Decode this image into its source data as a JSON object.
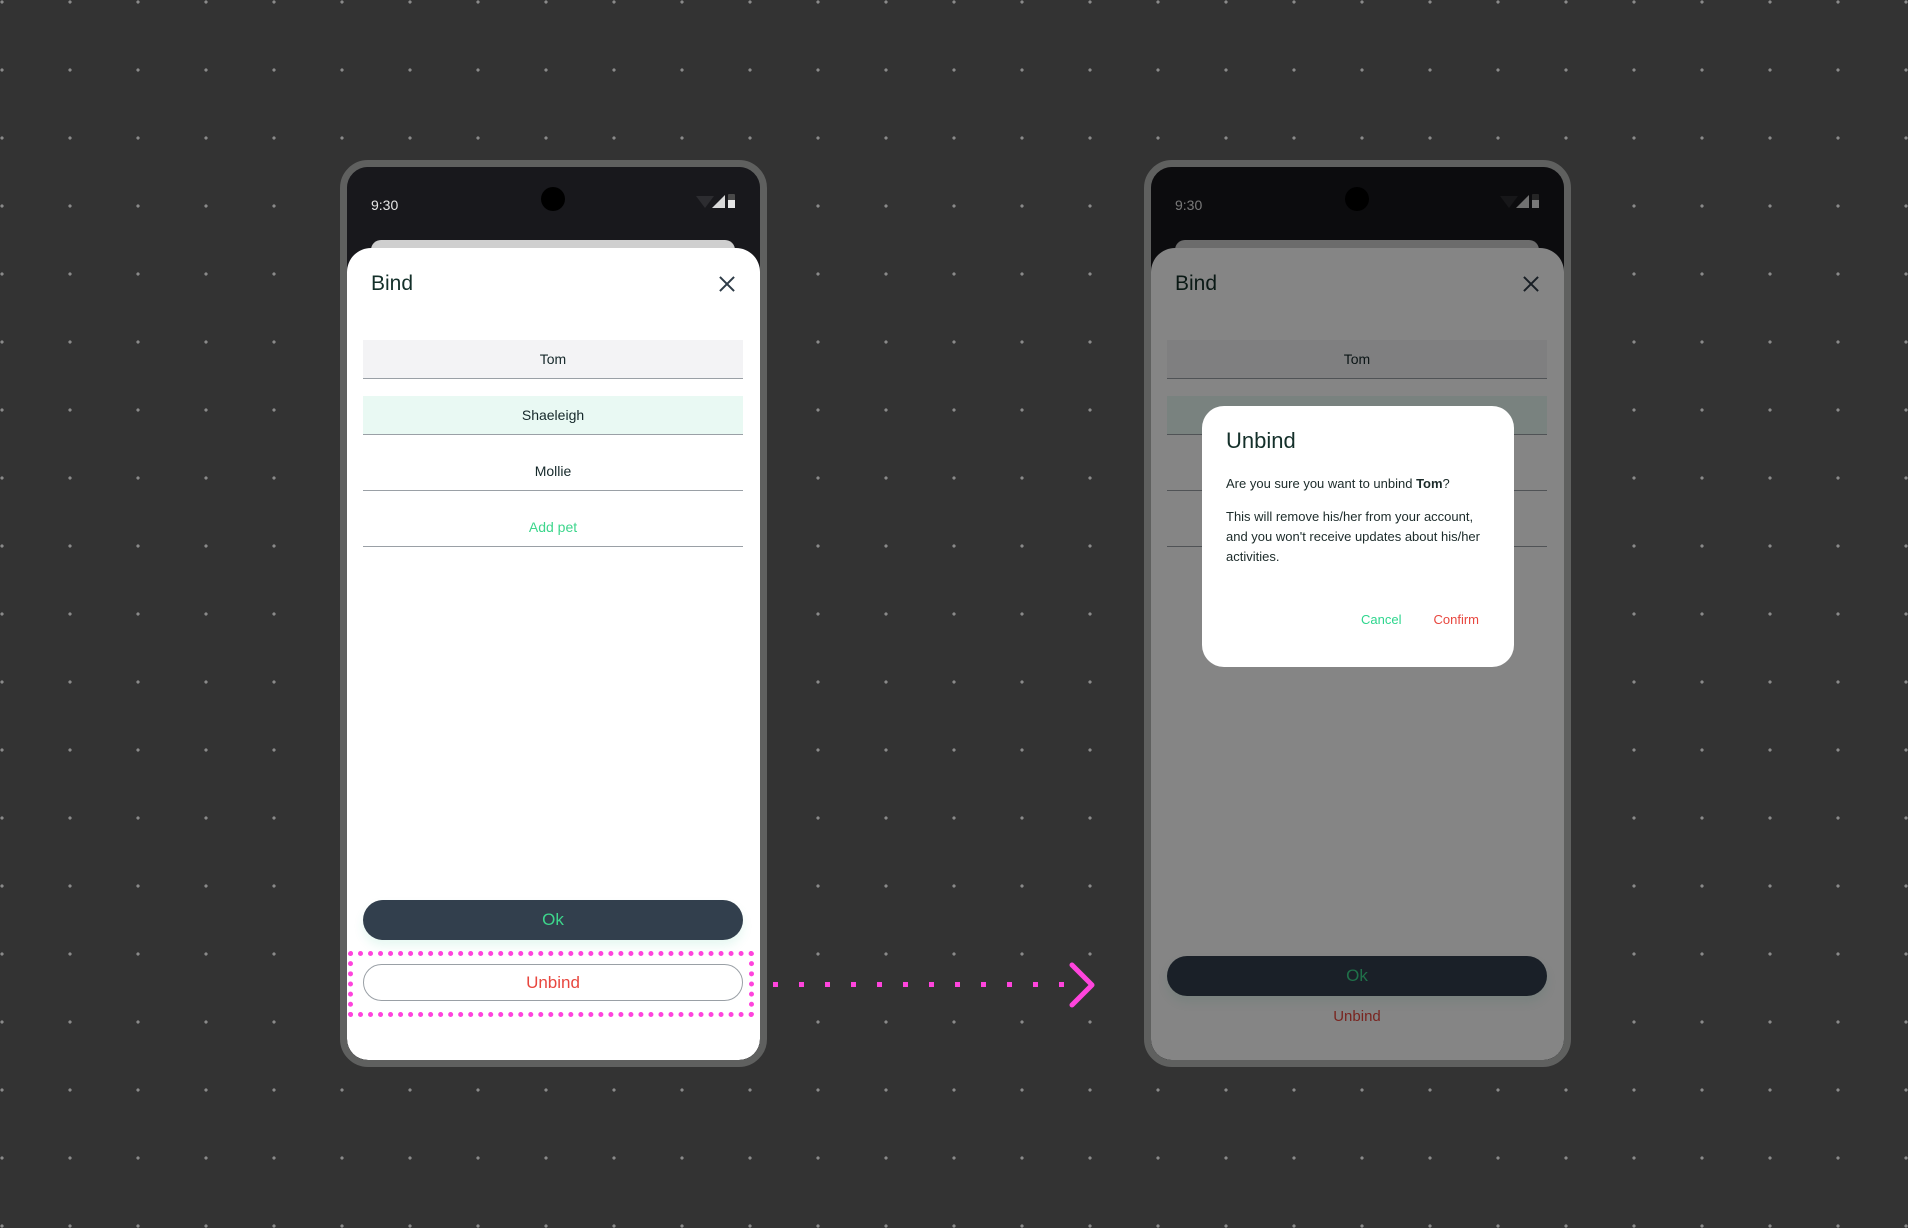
{
  "status_bar": {
    "time": "9:30"
  },
  "sheet": {
    "title": "Bind",
    "pets": [
      "Tom",
      "Shaeleigh",
      "Mollie"
    ],
    "add_pet_label": "Add pet",
    "ok_label": "Ok",
    "unbind_label": "Unbind"
  },
  "dialog": {
    "title": "Unbind",
    "question_prefix": "Are you sure you want to unbind ",
    "pet_name": "Tom",
    "question_suffix": "?",
    "message": "This will remove his/her from your account, and you won't receive updates about his/her activities.",
    "cancel_label": "Cancel",
    "confirm_label": "Confirm"
  },
  "colors": {
    "accent_green": "#3dd68c",
    "danger_red": "#e8473f",
    "button_dark": "#323f4d",
    "annotation_pink": "#ff44dd",
    "canvas_bg": "#333333"
  },
  "icons": {
    "close": "close-icon",
    "wifi": "wifi-icon",
    "signal": "cell-signal-icon",
    "battery": "battery-icon",
    "arrow": "flow-arrow-icon"
  }
}
